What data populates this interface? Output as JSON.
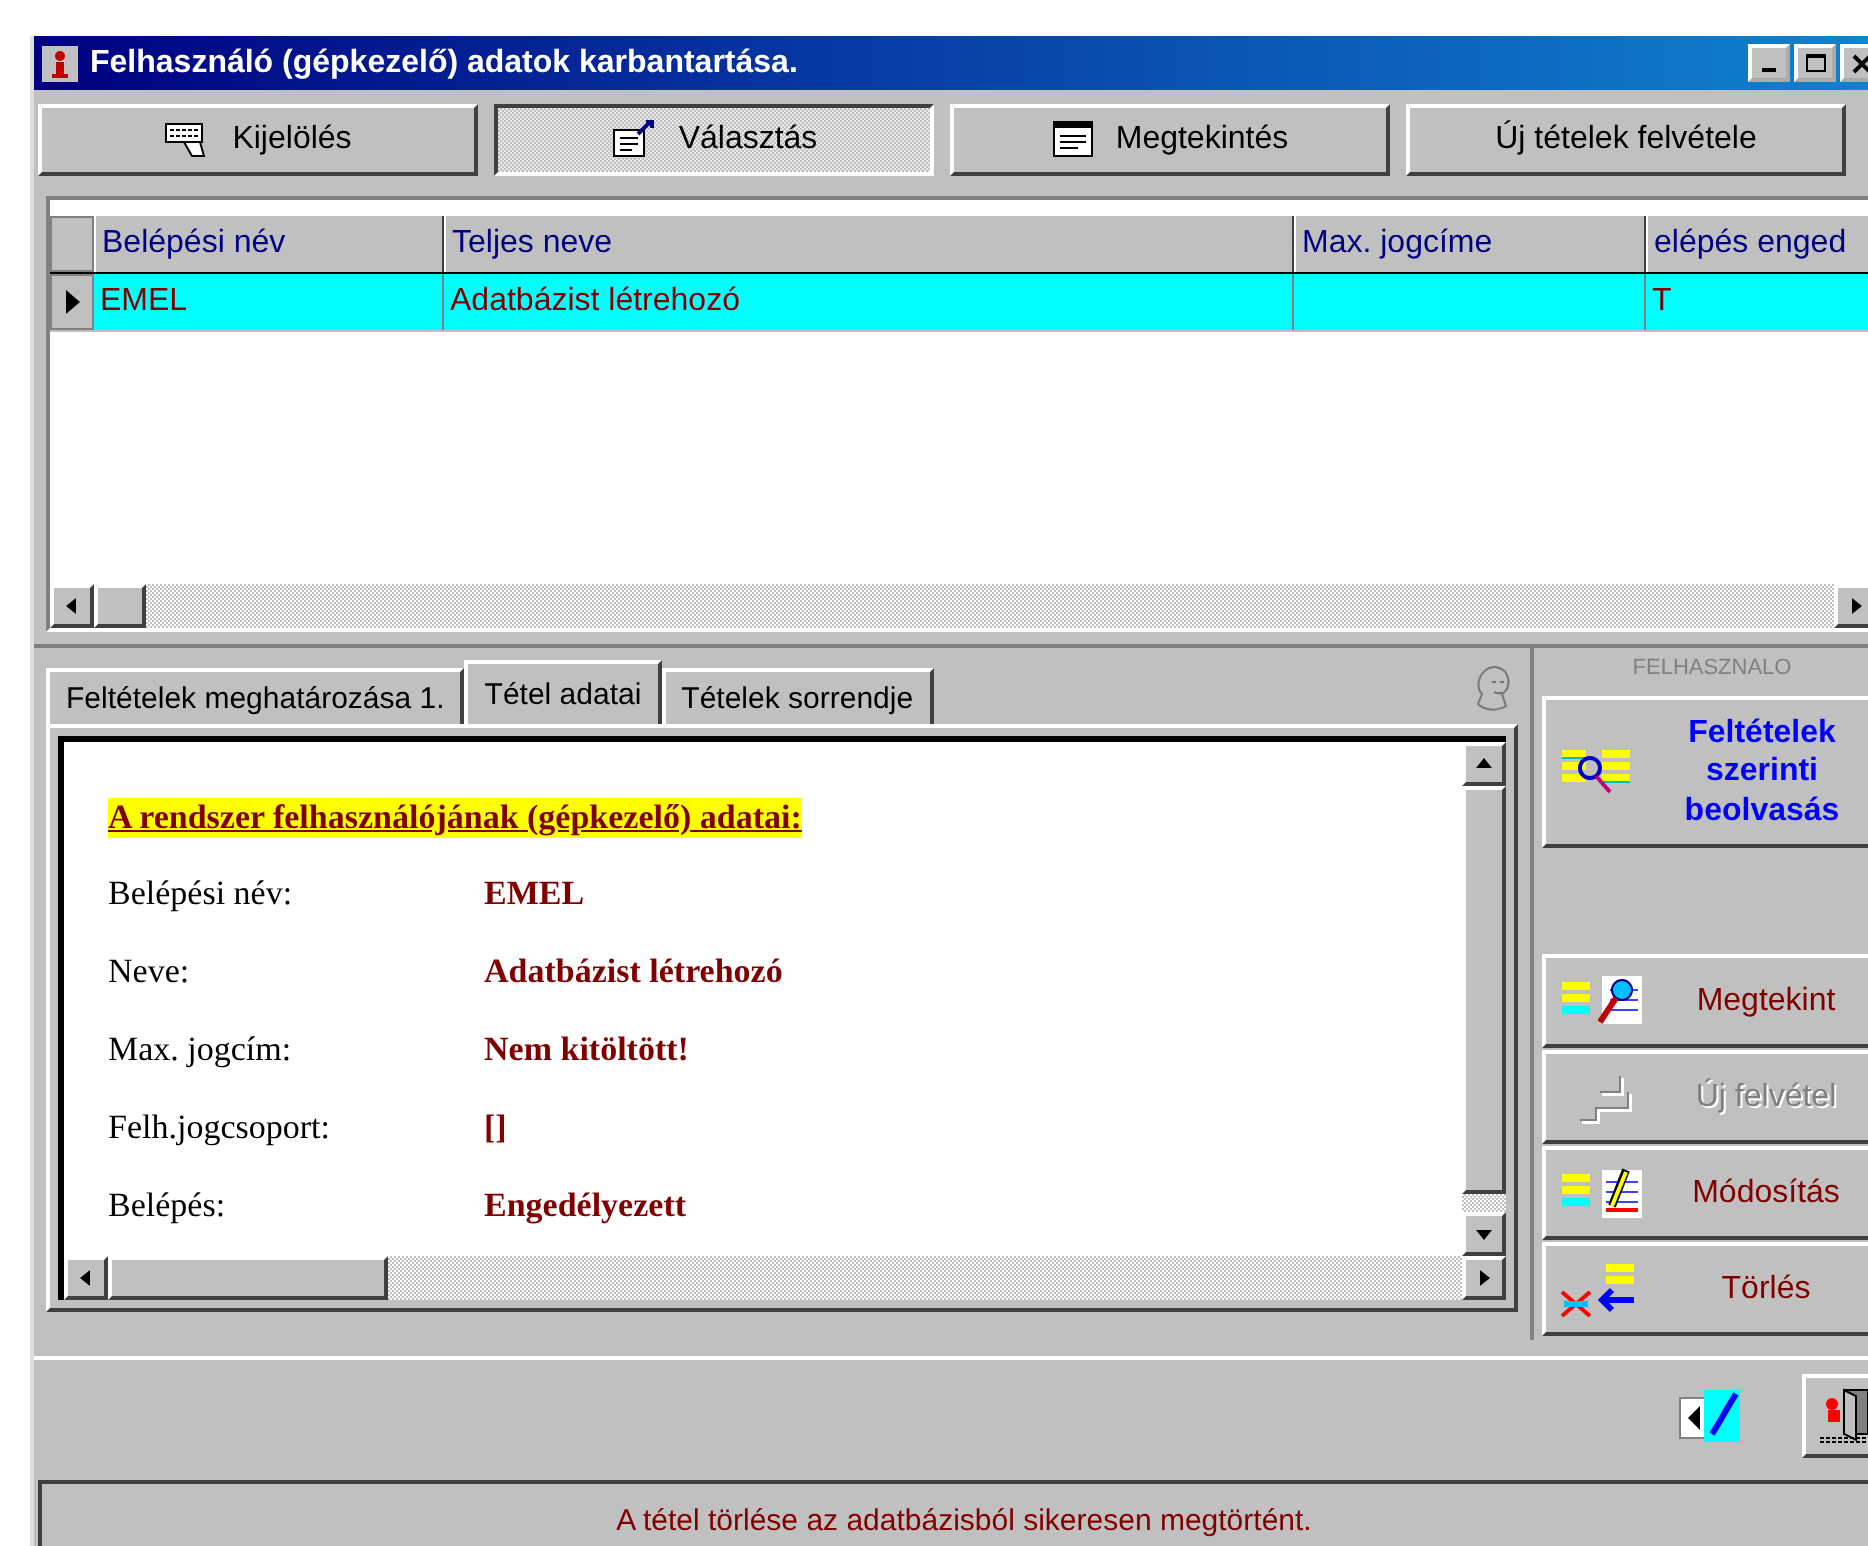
{
  "window": {
    "title": "Felhasználó (gépkezelő) adatok karbantartása."
  },
  "toolbar": [
    {
      "label": "Kijelölés",
      "kind": "keyboard",
      "selected": false
    },
    {
      "label": "Választás",
      "kind": "select",
      "selected": true
    },
    {
      "label": "Megtekintés",
      "kind": "view",
      "selected": false
    },
    {
      "label": "Új tételek felvétele",
      "kind": "none",
      "selected": false
    }
  ],
  "grid": {
    "columns": [
      "Belépési név",
      "Teljes neve",
      "Max. jogcíme",
      "elépés enged"
    ],
    "rows": [
      {
        "cells": [
          "EMEL",
          "Adatbázist létrehozó",
          "",
          "T"
        ],
        "selected": true
      }
    ]
  },
  "tabs": [
    {
      "label": "Feltételek meghatározása 1.",
      "selected": false
    },
    {
      "label": "Tétel adatai",
      "selected": true
    },
    {
      "label": "Tételek sorrendje",
      "selected": false
    }
  ],
  "detail": {
    "heading": "A rendszer felhasználójának (gépkezelő) adatai:",
    "fields": [
      {
        "label": "Belépési név:",
        "value": "EMEL"
      },
      {
        "label": "Neve:",
        "value": "Adatbázist létrehozó"
      },
      {
        "label": "Max. jogcím:",
        "value": "Nem kitöltött!"
      },
      {
        "label": "Felh.jogcsoport:",
        "value": "[]"
      },
      {
        "label": "Belépés:",
        "value": "Engedélyezett"
      }
    ]
  },
  "side_panel": {
    "caption": "FELHASZNALO",
    "buttons": [
      {
        "kind": "search",
        "lines": [
          "Feltételek",
          "szerinti",
          "beolvasás"
        ],
        "disabled": false
      },
      {
        "kind": "view",
        "lines": [
          "Megtekint"
        ],
        "disabled": false
      },
      {
        "kind": "new",
        "lines": [
          "Új felvétel"
        ],
        "disabled": true
      },
      {
        "kind": "edit",
        "lines": [
          "Módosítás"
        ],
        "disabled": false
      },
      {
        "kind": "delete",
        "lines": [
          "Törlés"
        ],
        "disabled": false
      }
    ]
  },
  "status": {
    "message": "A tétel törlése az adatbázisból sikeresen megtörtént."
  }
}
